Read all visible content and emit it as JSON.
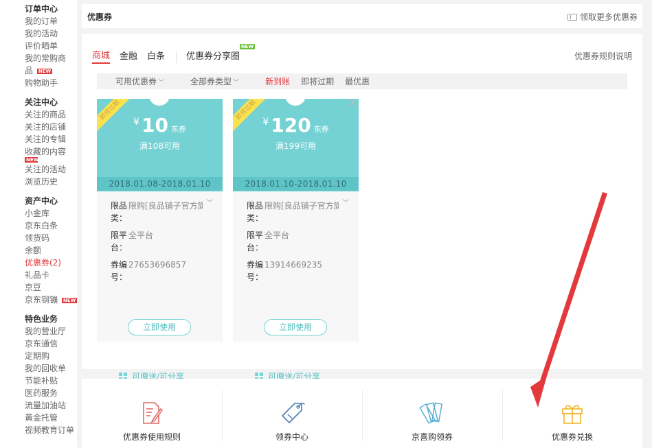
{
  "sidebar": {
    "sections": [
      {
        "title": "订单中心",
        "items": [
          {
            "label": "我的订单"
          },
          {
            "label": "我的活动"
          },
          {
            "label": "评价晒单"
          },
          {
            "label": "我的常购商"
          },
          {
            "label": "品",
            "new": "NEW"
          },
          {
            "label": "购物助手"
          }
        ]
      },
      {
        "title": "关注中心",
        "items": [
          {
            "label": "关注的商品"
          },
          {
            "label": "关注的店铺"
          },
          {
            "label": "关注的专辑"
          },
          {
            "label": "收藏的内容",
            "new_below": "NEW"
          },
          {
            "label": "关注的活动"
          },
          {
            "label": "浏览历史"
          }
        ]
      },
      {
        "title": "资产中心",
        "items": [
          {
            "label": "小金库"
          },
          {
            "label": "京东白条"
          },
          {
            "label": "领货码"
          },
          {
            "label": "余额"
          },
          {
            "label": "优惠券(2)",
            "active": true
          },
          {
            "label": "礼品卡"
          },
          {
            "label": "京豆"
          },
          {
            "label": "京东钢镚",
            "new": "NEW"
          }
        ]
      },
      {
        "title": "特色业务",
        "items": [
          {
            "label": "我的营业厅"
          },
          {
            "label": "京东通信"
          },
          {
            "label": "定期购"
          },
          {
            "label": "我的回收单"
          },
          {
            "label": "节能补贴"
          },
          {
            "label": "医药服务"
          },
          {
            "label": "流量加油站"
          },
          {
            "label": "黄金托管"
          },
          {
            "label": "视频教育订单"
          }
        ]
      }
    ]
  },
  "header": {
    "title": "优惠券",
    "more_link": "领取更多优惠券"
  },
  "tabs": {
    "items": [
      "商城",
      "金融",
      "白条"
    ],
    "share_tab": "优惠券分享圈",
    "share_new": "NEW",
    "rules_link": "优惠券规则说明"
  },
  "filters": {
    "available": "可用优惠券",
    "all_types": "全部券类型",
    "new_arrival": "新到账",
    "expiring": "即将过期",
    "best": "最优惠"
  },
  "coupons": [
    {
      "ribbon": "即将过期",
      "yen": "¥",
      "amount": "10",
      "unit": "东券",
      "condition": "满108可用",
      "dates": "2018.01.08-2018.01.10",
      "limit_key": "限品类：",
      "limit_val": "限购[良品铺子官方旗舰店]",
      "platform_key": "限平台：",
      "platform_val": "全平台",
      "code_key": "券编号：",
      "code_val": "27653696857",
      "button": "立即使用",
      "share": "可赠送/可分享"
    },
    {
      "ribbon": "即将过期",
      "yen": "¥",
      "amount": "120",
      "unit": "东券",
      "condition": "满199可用",
      "dates": "2018.01.10-2018.01.10",
      "limit_key": "限品类：",
      "limit_val": "限购[良品铺子官方旗舰店]",
      "platform_key": "限平台：",
      "platform_val": "全平台",
      "code_key": "券编号：",
      "code_val": "13914669235",
      "button": "立即使用",
      "share": "可赠送/可分享",
      "close": "✕"
    }
  ],
  "bottom": [
    {
      "label": "优惠券使用规则",
      "icon": "document-pen-icon"
    },
    {
      "label": "领券中心",
      "icon": "tag-icon"
    },
    {
      "label": "京喜购领券",
      "icon": "tickets-icon"
    },
    {
      "label": "优惠券兑换",
      "icon": "gift-icon"
    }
  ],
  "colors": {
    "accent": "#e4393c",
    "coupon": "#74d2d4",
    "annotation_arrow": "#e4393c"
  }
}
